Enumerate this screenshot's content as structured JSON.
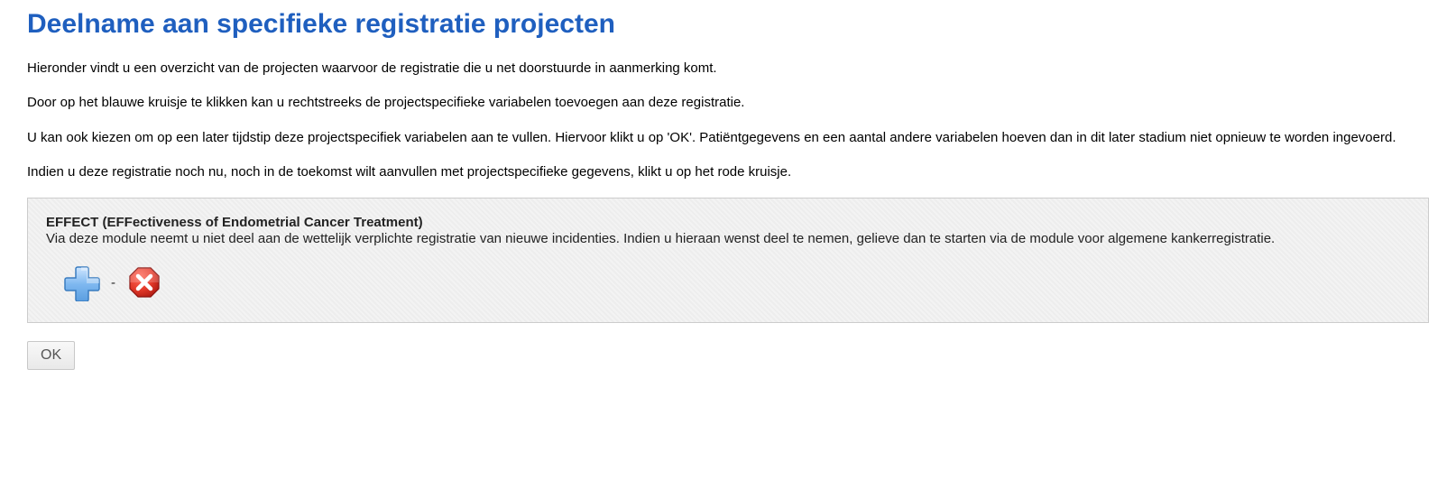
{
  "page": {
    "title": "Deelname aan specifieke registratie projecten"
  },
  "intro": {
    "p1": "Hieronder vindt u een overzicht van de projecten waarvoor de registratie die u net doorstuurde in aanmerking komt.",
    "p2": "Door op het blauwe kruisje te klikken kan u rechtstreeks de projectspecifieke variabelen toevoegen aan deze registratie.",
    "p3": "U kan ook kiezen om op een later tijdstip deze projectspecifiek variabelen aan te vullen. Hiervoor klikt u op 'OK'. Patiëntgegevens en een aantal andere variabelen hoeven dan in dit later stadium niet opnieuw te worden ingevoerd.",
    "p4": "Indien u deze registratie noch nu, noch in de toekomst wilt aanvullen met projectspecifieke gegevens, klikt u op het rode kruisje."
  },
  "project": {
    "title": "EFFECT (EFFectiveness of Endometrial Cancer Treatment)",
    "description": "Via deze module neemt u niet deel aan de wettelijk verplichte registratie van nieuwe incidenties. Indien u hieraan wenst deel te nemen, gelieve dan te starten via de module voor algemene kankerregistratie.",
    "separator": "-"
  },
  "buttons": {
    "ok_label": "OK"
  }
}
